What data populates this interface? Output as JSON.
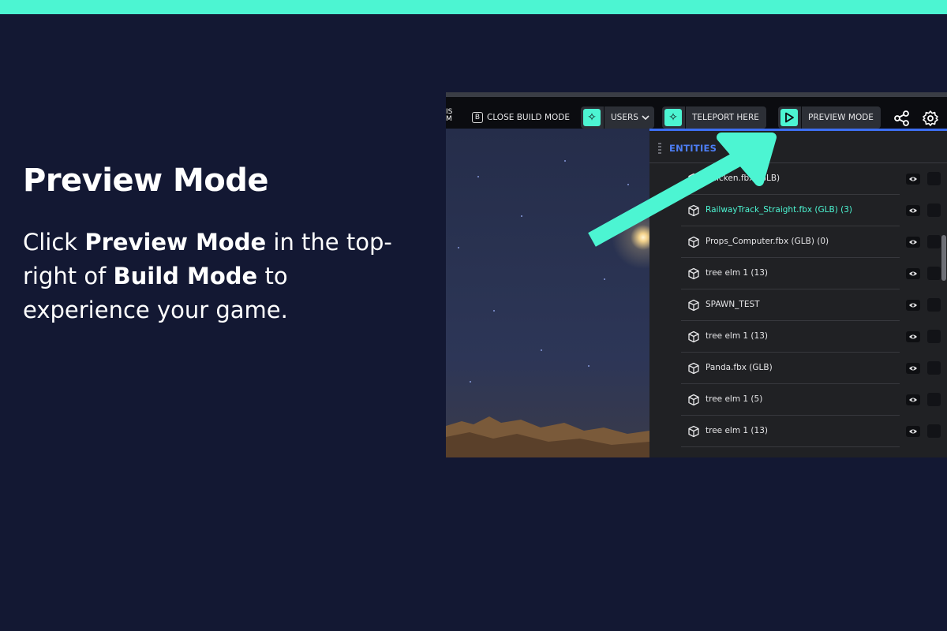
{
  "slide": {
    "title": "Preview Mode",
    "body": {
      "part1": "Click ",
      "em1": "Preview Mode",
      "part2": " in the top-right of ",
      "em2": "Build Mode",
      "part3": " to experience your game."
    }
  },
  "colors": {
    "accent": "#4cf5d2",
    "background": "#131833",
    "entities_title": "#4d7ef5"
  },
  "toolbar": {
    "cut_text": "IS\nM",
    "close_build_key": "B",
    "close_build_label": "CLOSE BUILD MODE",
    "users_label": "USERS",
    "teleport_label": "TELEPORT HERE",
    "preview_label": "PREVIEW MODE",
    "icons": [
      "sparkle-icon",
      "chevron-down-icon",
      "play-icon",
      "share-icon",
      "gear-icon"
    ]
  },
  "entities": {
    "title": "ENTITIES",
    "items": [
      {
        "name": "Chicken.fbx (GLB)",
        "selected": false
      },
      {
        "name": "RailwayTrack_Straight.fbx (GLB) (3)",
        "selected": true
      },
      {
        "name": "Props_Computer.fbx (GLB) (0)",
        "selected": false
      },
      {
        "name": "tree elm 1 (13)",
        "selected": false
      },
      {
        "name": "SPAWN_TEST",
        "selected": false
      },
      {
        "name": "tree elm 1 (13)",
        "selected": false
      },
      {
        "name": "Panda.fbx (GLB)",
        "selected": false
      },
      {
        "name": "tree elm 1 (5)",
        "selected": false
      },
      {
        "name": "tree elm 1 (13)",
        "selected": false
      }
    ]
  }
}
